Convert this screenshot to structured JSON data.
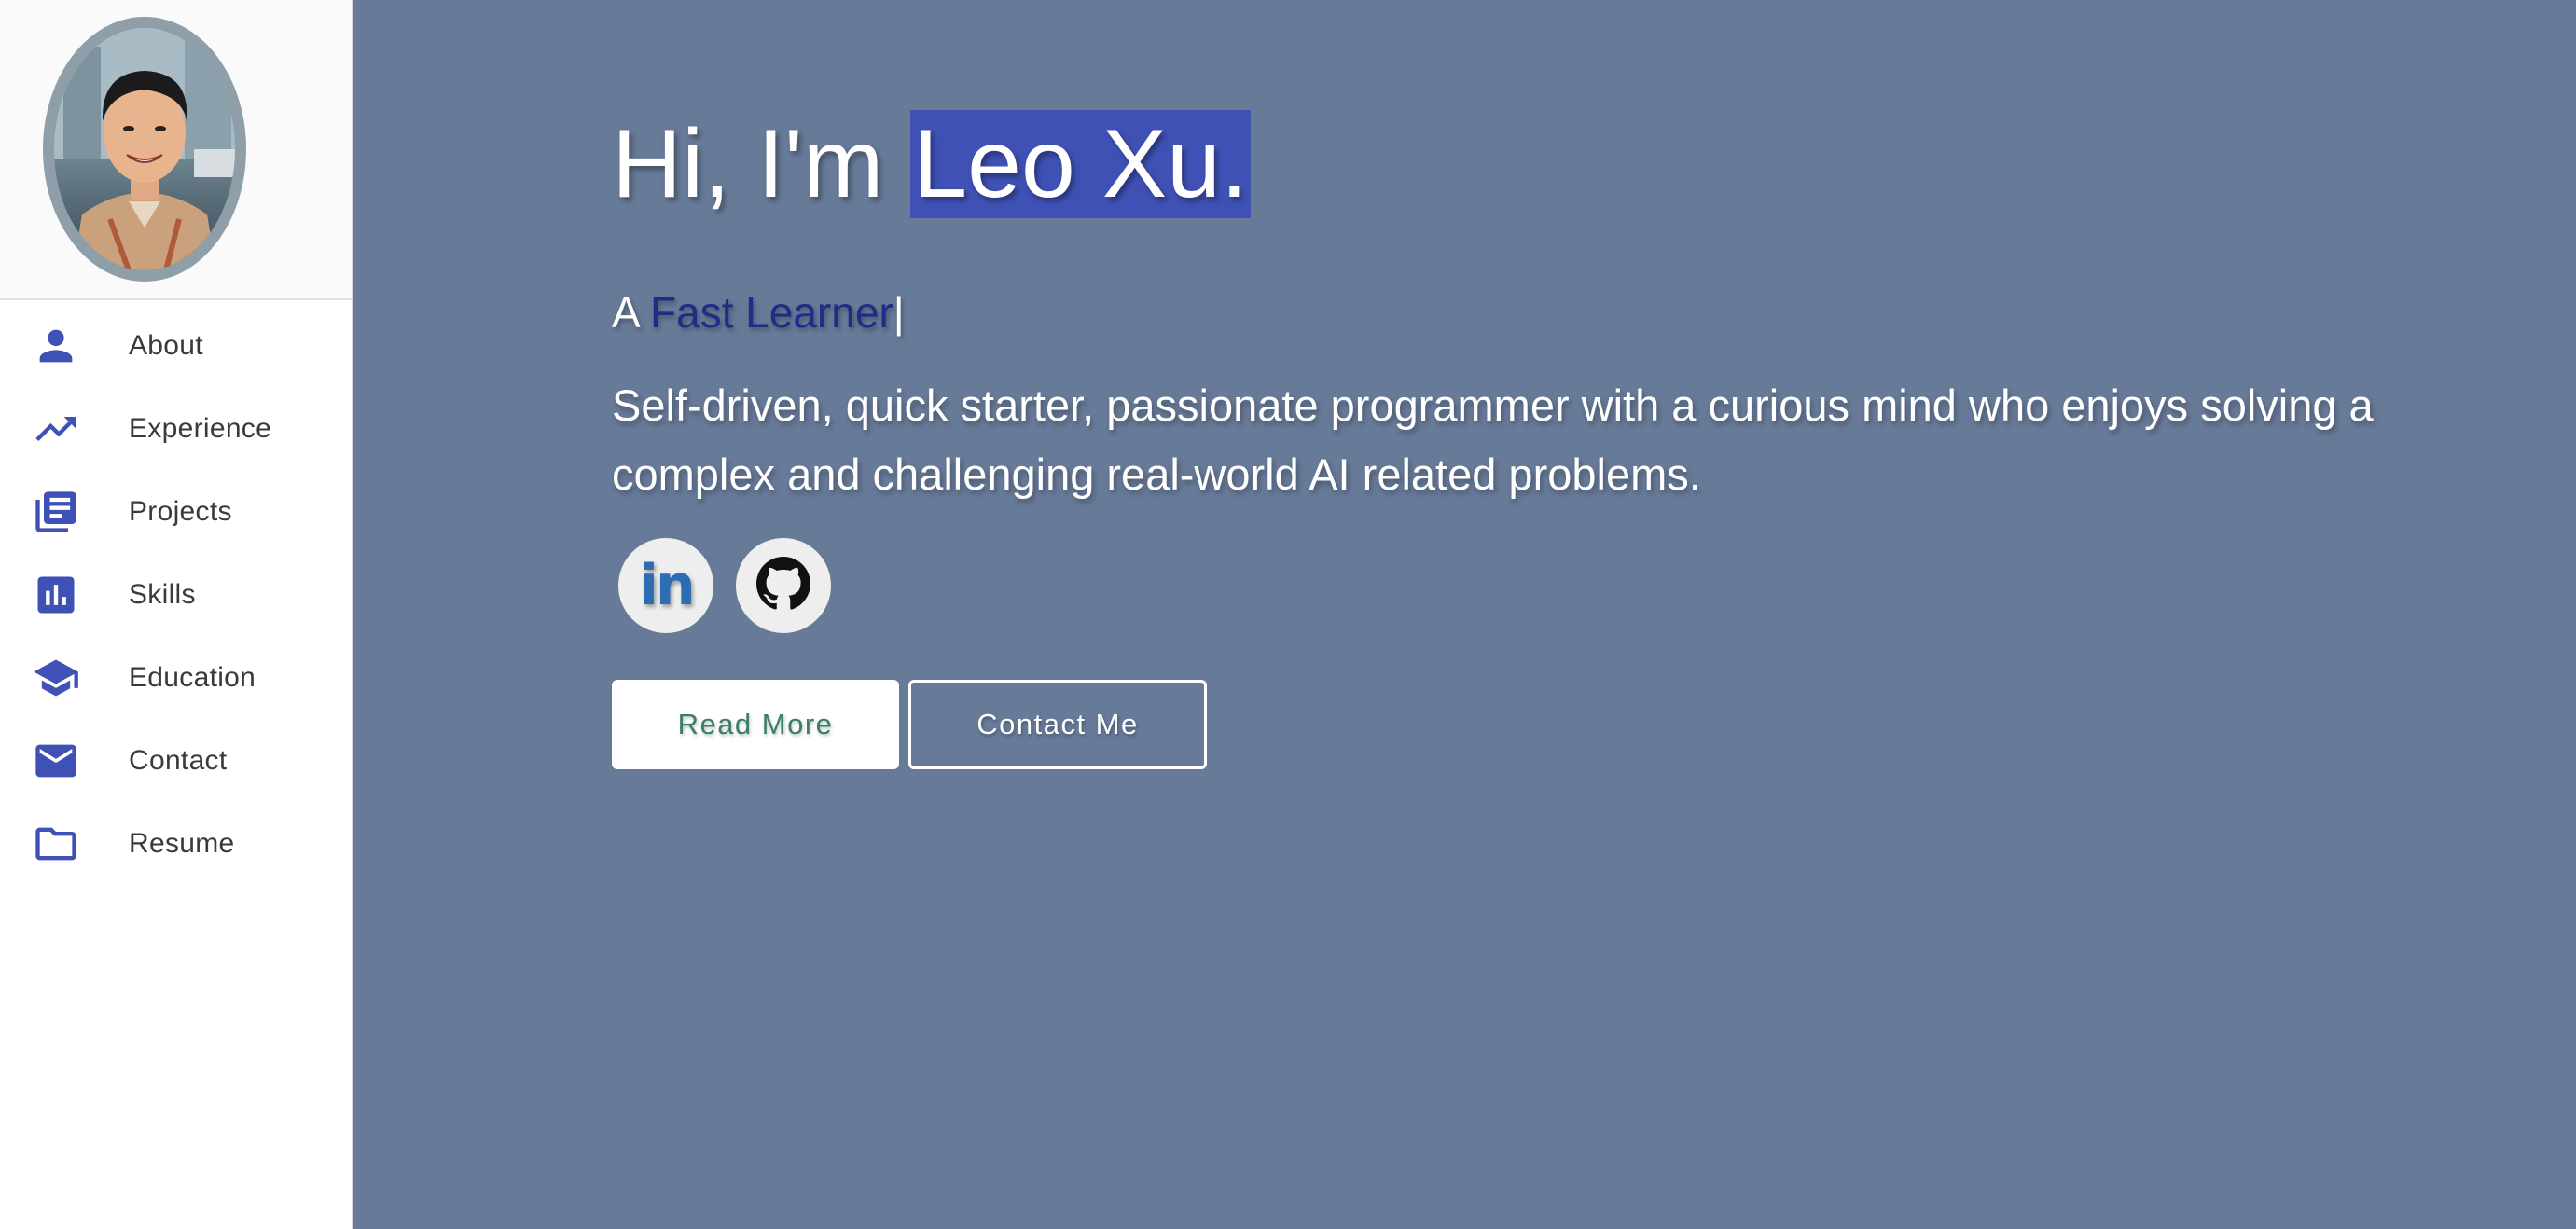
{
  "profile": {
    "avatar_alt": "Leo Xu profile photo"
  },
  "sidebar": {
    "items": [
      {
        "label": "About",
        "icon": "person-icon"
      },
      {
        "label": "Experience",
        "icon": "trending-up-icon"
      },
      {
        "label": "Projects",
        "icon": "library-books-icon"
      },
      {
        "label": "Skills",
        "icon": "bar-chart-icon"
      },
      {
        "label": "Education",
        "icon": "graduation-cap-icon"
      },
      {
        "label": "Contact",
        "icon": "mail-icon"
      },
      {
        "label": "Resume",
        "icon": "folder-icon"
      }
    ]
  },
  "hero": {
    "greeting": "Hi, I'm ",
    "name": "Leo Xu.",
    "tagline_prefix": "A ",
    "tagline_typed": "Fast Learner",
    "tagline_cursor": "|",
    "description": "Self-driven, quick starter, passionate programmer with a curious mind who enjoys solving a complex and challenging real-world AI related problems."
  },
  "social": {
    "linkedin_text": "in",
    "linkedin_icon": "linkedin-icon",
    "github_icon": "github-icon"
  },
  "buttons": {
    "read_more": "Read More",
    "contact_me": "Contact Me"
  },
  "colors": {
    "background": "#677a98",
    "accent": "#3f51b5",
    "tagline_accent": "#1f2d86",
    "read_more_text": "#3b7e6a"
  }
}
